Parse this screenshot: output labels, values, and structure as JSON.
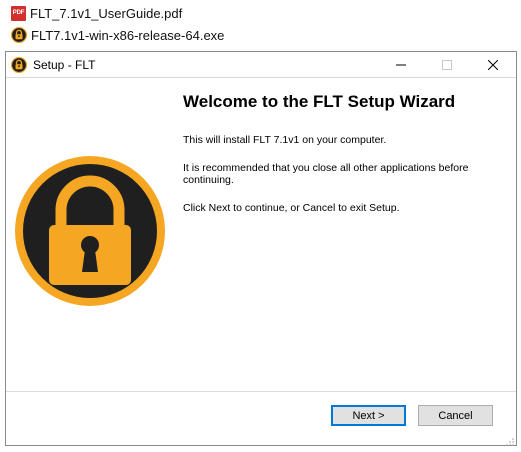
{
  "files": [
    {
      "name": "FLT_7.1v1_UserGuide.pdf",
      "icon": "pdf-file-icon",
      "icon_label": "PDF"
    },
    {
      "name": "FLT7.1v1-win-x86-release-64.exe",
      "icon": "lock-app-icon"
    }
  ],
  "window": {
    "title": "Setup - FLT",
    "controls": [
      "minimize",
      "maximize",
      "close"
    ]
  },
  "wizard": {
    "heading": "Welcome to the FLT Setup Wizard",
    "para1": "This will install FLT 7.1v1 on your computer.",
    "para2": "It is recommended that you close all other applications before continuing.",
    "para3": "Click Next to continue, or Cancel to exit Setup."
  },
  "buttons": {
    "next_label": "Next >",
    "cancel_label": "Cancel"
  },
  "colors": {
    "lock_gold": "#f5a623",
    "lock_dark": "#1f1f1f",
    "pdf_red": "#d32f2f",
    "focus_blue": "#0078d7"
  }
}
